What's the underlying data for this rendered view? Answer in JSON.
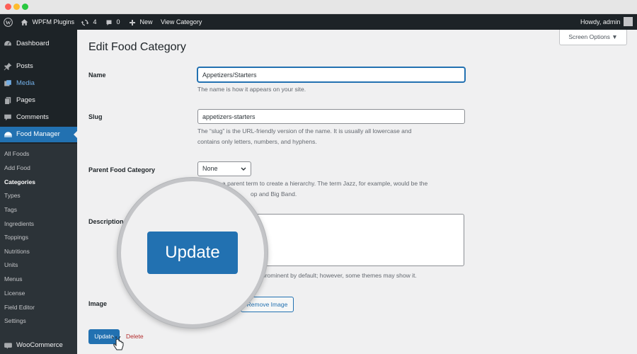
{
  "admin_bar": {
    "site_name": "WPFM Plugins",
    "updates_count": "4",
    "comments_count": "0",
    "new_label": "New",
    "view_category_label": "View Category",
    "howdy": "Howdy, admin"
  },
  "sidebar": {
    "items": {
      "dashboard": "Dashboard",
      "posts": "Posts",
      "media": "Media",
      "pages": "Pages",
      "comments": "Comments",
      "food_manager": "Food Manager",
      "woocommerce": "WooCommerce"
    },
    "submenu": [
      "All Foods",
      "Add Food",
      "Categories",
      "Types",
      "Tags",
      "Ingredients",
      "Toppings",
      "Nutritions",
      "Units",
      "Menus",
      "License",
      "Field Editor",
      "Settings"
    ],
    "current_submenu": "Categories"
  },
  "screen_options": "Screen Options ▼",
  "page_title": "Edit Food Category",
  "form": {
    "name_label": "Name",
    "name_value": "Appetizers/Starters",
    "name_desc": "The name is how it appears on your site.",
    "slug_label": "Slug",
    "slug_value": "appetizers-starters",
    "slug_desc_1": "The “slug” is the URL-friendly version of the name. It is usually all lowercase and",
    "slug_desc_2": "contains only letters, numbers, and hyphens.",
    "parent_label": "Parent Food Category",
    "parent_value": "None",
    "parent_desc_1": "a parent term to create a hierarchy. The term Jazz, for example, would be the",
    "parent_desc_2": "op and Big Band.",
    "description_label": "Description",
    "description_desc": "prominent by default; however, some themes may show it.",
    "image_label": "Image",
    "remove_image": "Remove Image",
    "update": "Update",
    "delete": "Delete"
  },
  "zoom": {
    "update_label": "Update"
  },
  "colors": {
    "primary": "#2271b1",
    "admin_dark": "#1d2327",
    "submenu_bg": "#2c3338",
    "delete": "#b32d2e"
  }
}
